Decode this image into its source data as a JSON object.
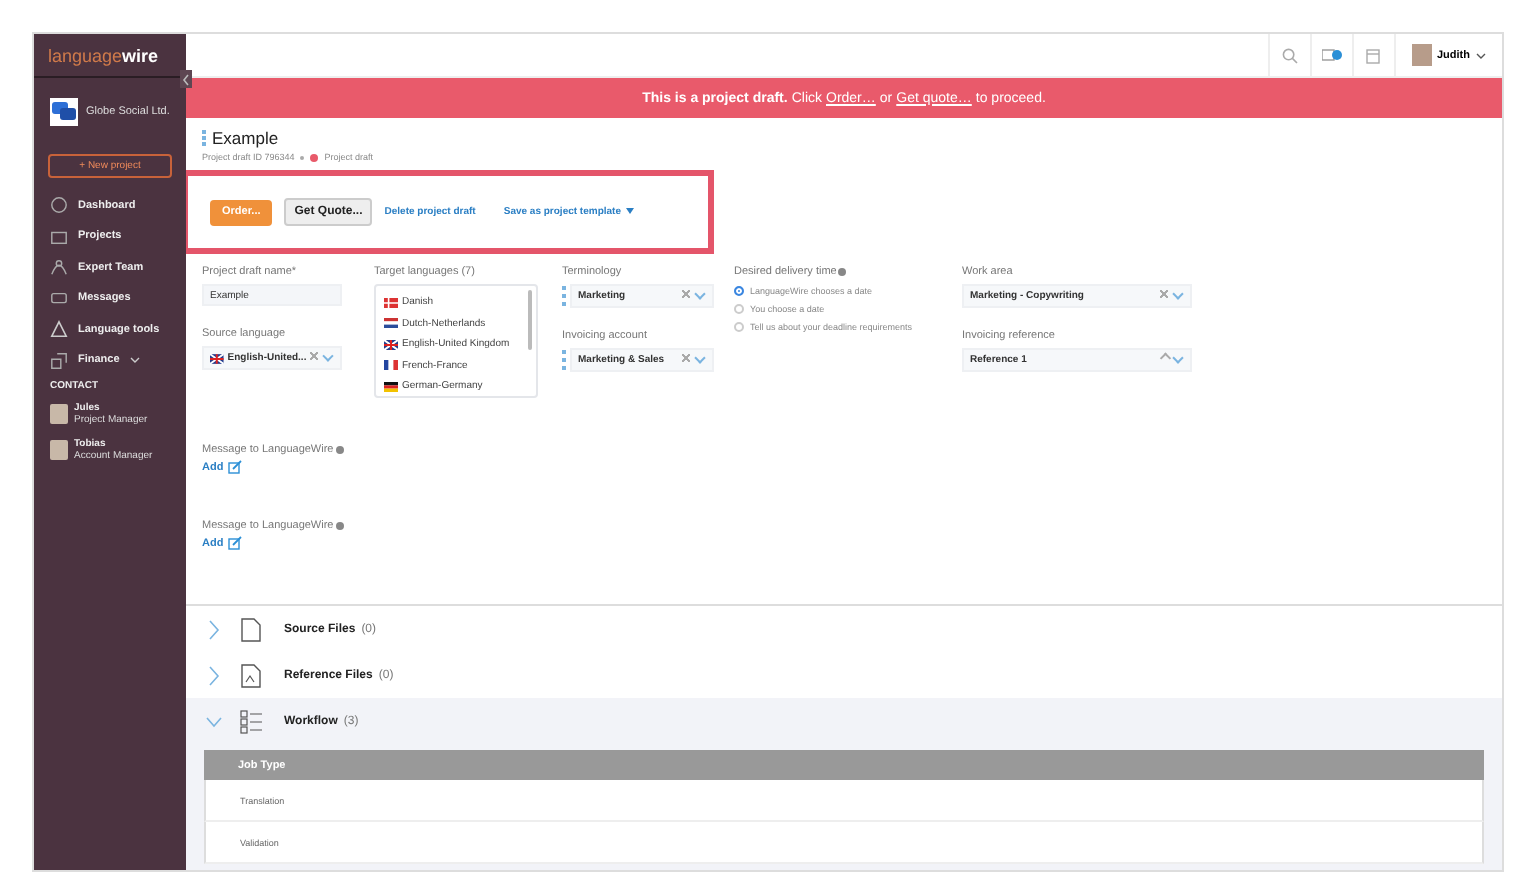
{
  "sidebar": {
    "logo_light": "language",
    "logo_bold": "wire",
    "company": "Globe Social Ltd.",
    "new_project": "+ New project",
    "nav": [
      {
        "label": "Dashboard",
        "menu": false
      },
      {
        "label": "Projects",
        "menu": false
      },
      {
        "label": "Expert Team",
        "menu": false
      },
      {
        "label": "Messages",
        "menu": false
      },
      {
        "label": "Language tools",
        "menu": false
      },
      {
        "label": "Finance",
        "menu": true
      }
    ],
    "contact_heading": "CONTACT",
    "contacts": [
      {
        "name": "Jules",
        "role": "Project Manager"
      },
      {
        "name": "Tobias",
        "role": "Account Manager"
      }
    ]
  },
  "header": {
    "user": "Judith"
  },
  "banner": {
    "lead": "This is a project draft.",
    "click": "Click",
    "order_link": "Order…",
    "or": "or",
    "quote_link": "Get quote…",
    "tail": "to proceed."
  },
  "project": {
    "title": "Example",
    "id": "Project draft ID 796344",
    "status": "Project draft"
  },
  "actions": {
    "order": "Order...",
    "quote": "Get Quote...",
    "delete": "Delete project draft",
    "template": "Save as project template"
  },
  "form": {
    "name_label": "Project draft name*",
    "name_value": "Example",
    "source_label": "Source language",
    "source_value": "English-United...",
    "target_label": "Target languages (7)",
    "targets": [
      "Danish",
      "Dutch-Netherlands",
      "English-United Kingdom",
      "French-France",
      "German-Germany"
    ],
    "terminology_label": "Terminology",
    "terminology_value": "Marketing",
    "account_label": "Invoicing account",
    "account_value": "Marketing & Sales",
    "delivery_label": "Desired delivery time",
    "delivery_options": [
      {
        "label": "LanguageWire chooses a date",
        "selected": true
      },
      {
        "label": "You choose a date",
        "selected": false
      },
      {
        "label": "Tell us about your deadline requirements",
        "selected": false
      }
    ],
    "work_label": "Work area",
    "work_value": "Marketing - Copywriting",
    "reference_label": "Invoicing reference",
    "reference_value": "Reference 1",
    "messages": [
      {
        "label": "Message to LanguageWire",
        "add": "Add"
      },
      {
        "label": "Message to LanguageWire",
        "add": "Add"
      }
    ]
  },
  "sections": [
    {
      "title": "Source Files",
      "count": "(0)",
      "expanded": false
    },
    {
      "title": "Reference Files",
      "count": "(0)",
      "expanded": false
    },
    {
      "title": "Workflow",
      "count": "(3)",
      "expanded": true
    }
  ],
  "workflow_table": {
    "column": "Job Type",
    "rows": [
      "Translation",
      "Validation"
    ]
  }
}
